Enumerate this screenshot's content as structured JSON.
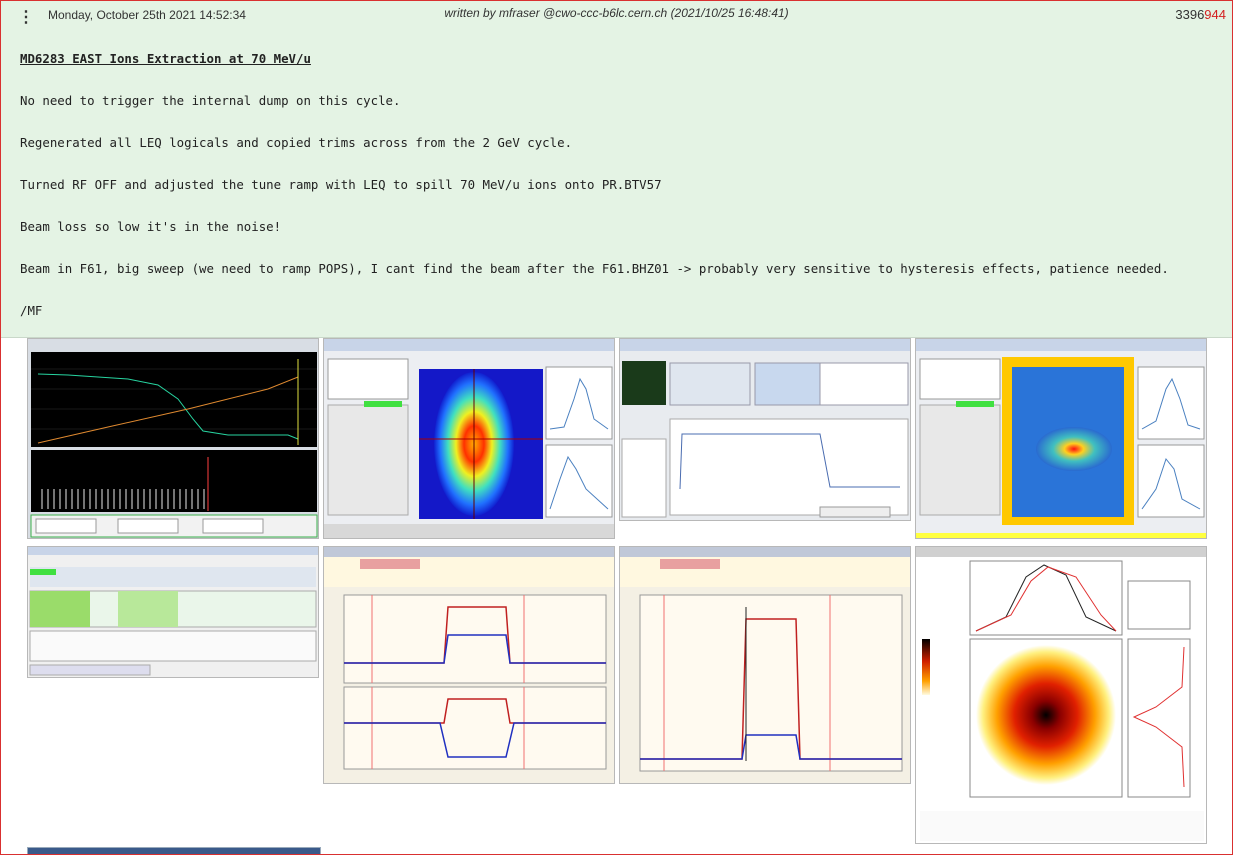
{
  "entry": {
    "menu_icon": "⋮",
    "date": "Monday, October 25th 2021 14:52:34",
    "author": "written by mfraser @cwo-ccc-b6lc.cern.ch (2021/10/25 16:48:41)",
    "id_prefix": "3396",
    "id_highlight": "944"
  },
  "body": {
    "title": "MD6283 EAST Ions Extraction at 70 MeV/u",
    "paragraphs": [
      "No need to trigger the internal dump on this cycle.",
      "Regenerated all LEQ logicals and copied trims across from the 2 GeV cycle.",
      "Turned RF OFF and adjusted the tune ramp with LEQ to spill 70 MeV/u ions onto PR.BTV57",
      "Beam loss so low it's in the noise!",
      "Beam in F61, big sweep (we need to ramp POPS), I cant find the beam after the F61.BHZ01 -> probably very sensitive to hysteresis effects, patience needed.",
      "/MF"
    ]
  },
  "attachments": [
    {
      "name": "screenshot-intensity-trend",
      "icon": "line-chart-icon"
    },
    {
      "name": "screenshot-btv-beam-image",
      "icon": "heatmap-icon"
    },
    {
      "name": "screenshot-tune-ramp-leq",
      "icon": "line-chart-icon"
    },
    {
      "name": "screenshot-btv57-profile",
      "icon": "heatmap-icon"
    },
    {
      "name": "screenshot-settings-table",
      "icon": "table-icon"
    },
    {
      "name": "screenshot-f61-currents",
      "icon": "line-chart-icon"
    },
    {
      "name": "screenshot-f61-bhz01",
      "icon": "line-chart-icon"
    },
    {
      "name": "screenshot-tomogram",
      "icon": "heatmap-icon"
    }
  ],
  "colors": {
    "header_bg": "#e4f3e4",
    "border": "#d93030",
    "id_highlight": "#d42020"
  }
}
